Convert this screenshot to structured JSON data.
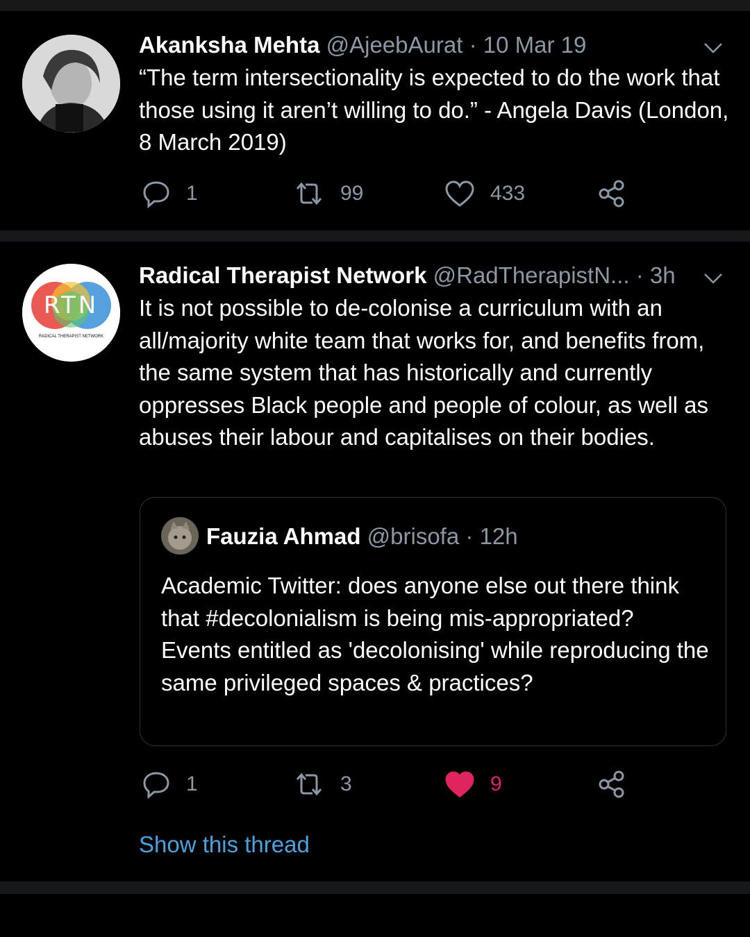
{
  "tweets": [
    {
      "name": "Akanksha Mehta",
      "handle": "@AjeebAurat",
      "sep": "·",
      "time": "10 Mar 19",
      "text": "“The term intersectionality is expected to do the work that those using it aren’t willing to do.” - Angela Davis (London, 8 March 2019)",
      "replies": "1",
      "retweets": "99",
      "likes": "433",
      "liked": false
    },
    {
      "name": "Radical Therapist Network",
      "handle": "@RadTherapistN...",
      "sep": "·",
      "time": "3h",
      "avatar_logo": "RTN",
      "avatar_caption": "RADICAL THERAPIST NETWORK",
      "text": "It is not possible to de-colonise a curriculum with an all/majority white team that works for, and benefits from, the same system that has historically and currently oppresses Black people and people of colour, as well as abuses their labour and capitalises on their bodies.",
      "replies": "1",
      "retweets": "3",
      "likes": "9",
      "liked": true,
      "quote": {
        "name": "Fauzia Ahmad",
        "handle": "@brisofa",
        "sep": "·",
        "time": "12h",
        "text": "Academic Twitter: does anyone else out there think that #decolonialism is being mis-appropriated? Events entitled as 'decolonising' while reproducing the same privileged spaces & practices?"
      },
      "show_thread": "Show this thread"
    }
  ],
  "colors": {
    "background": "#000000",
    "muted": "#8b98a5",
    "link": "#4aa3df",
    "like": "#e0245e",
    "divider": "#16181c"
  },
  "icons": [
    "reply-icon",
    "retweet-icon",
    "like-icon",
    "share-icon",
    "chevron-down-icon"
  ]
}
